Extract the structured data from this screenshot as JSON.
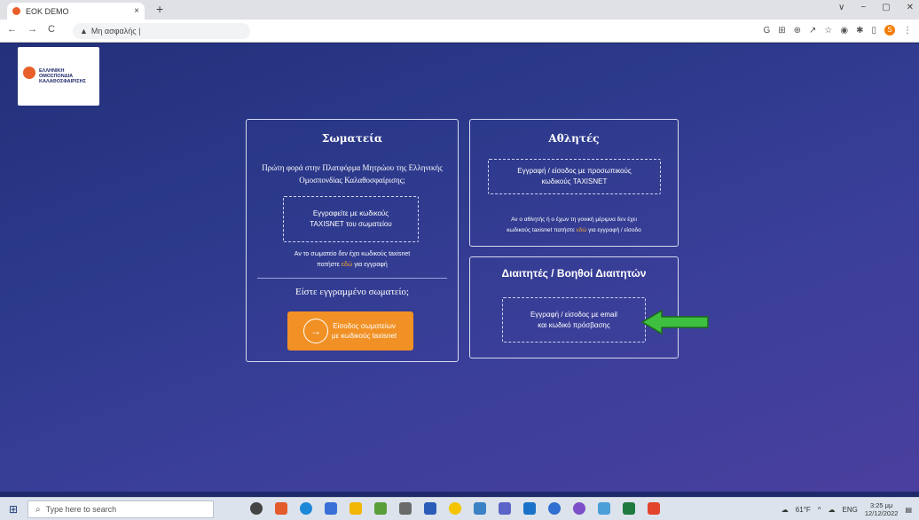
{
  "browser": {
    "tab_title": "EOK DEMO",
    "tab_close": "×",
    "new_tab": "+",
    "address_warning": "▲",
    "address_text": "Μη ασφαλής |",
    "window_controls": [
      "∨",
      "−",
      "▢",
      "✕"
    ],
    "profile_initial": "S"
  },
  "page": {
    "logo_text": [
      "ΕΛΛΗΝΙΚΗ",
      "ΟΜΟΣΠΟΝΔΙΑ",
      "ΚΑΛΑΘΟΣΦΑΙΡΙΣΗΣ"
    ],
    "clubs": {
      "title": "Σωματεία",
      "intro": "Πρώτη φορά στην Πλατφόρμα Μητρώου της Ελληνικής Ομοσπονδίας Καλαθοσφαίρισης;",
      "register_box": [
        "Εγγραφείτε με κωδικούς",
        "TAXISNET του σωματείου"
      ],
      "note_prefix": "Αν το σωματείο δεν έχει κωδικούς taxisnet",
      "note_pre": "πατήστε ",
      "note_link": "εδώ",
      "note_post": " για εγγραφή",
      "registered": "Είστε εγγραμμένο σωματείο;",
      "login_button": [
        "Είσοδος σωματείων",
        "με κωδικούς taxisnet"
      ],
      "login_icon": "→"
    },
    "athletes": {
      "title": "Αθλητές",
      "box": [
        "Εγγραφή / είσοδος με προσωπικούς",
        "κωδικούς TAXISNET"
      ],
      "note_line1": "Αν ο αθλητής ή ο έχων τη γονική μέριμνα δεν έχει",
      "note_pre": "κωδικούς taxisnet πατήστε ",
      "note_link": "εδώ",
      "note_post": " για εγγραφή / είσοδο"
    },
    "referees": {
      "title": "Διαιτητές / Βοηθοί Διαιτητών",
      "box": [
        "Εγγραφή / είσοδος με email",
        "και κωδικό πρόσβασης"
      ]
    }
  },
  "taskbar": {
    "search_placeholder": "Type here to search",
    "temperature": "61°F",
    "language": "ENG",
    "time": "3:25 μμ",
    "date": "12/12/2022"
  },
  "colors": {
    "accent_orange": "#f19125",
    "link_yellow": "#f4a72a",
    "arrow_green": "#3fbf3f"
  }
}
